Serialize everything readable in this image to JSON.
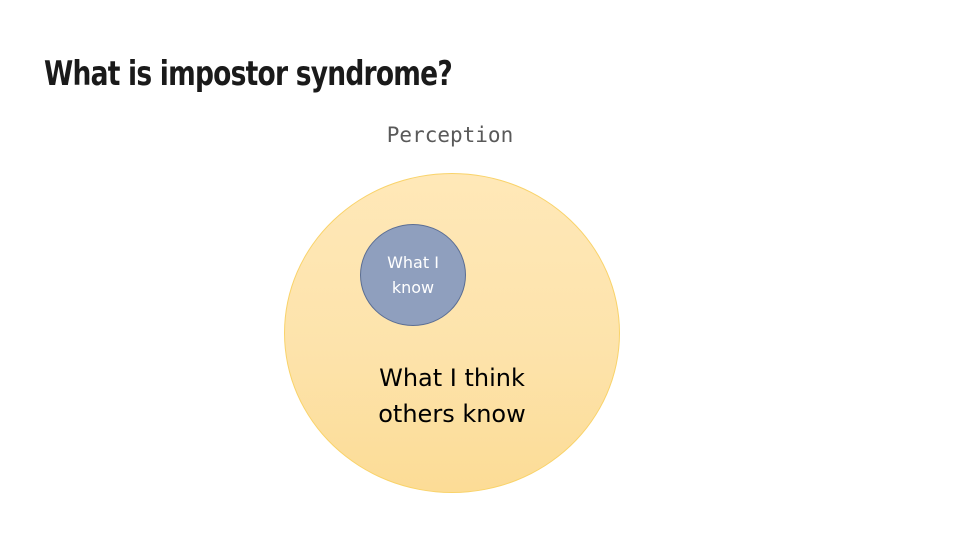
{
  "slide": {
    "title": "What is impostor syndrome?",
    "diagram_heading": "Perception"
  },
  "diagram": {
    "outer": {
      "label": "What I think\nothers know",
      "color": "#fde3ab",
      "border_color": "#f9d36a"
    },
    "inner": {
      "label": "What I\nknow",
      "color": "#8f9fbe",
      "border_color": "#5b6e94"
    }
  }
}
